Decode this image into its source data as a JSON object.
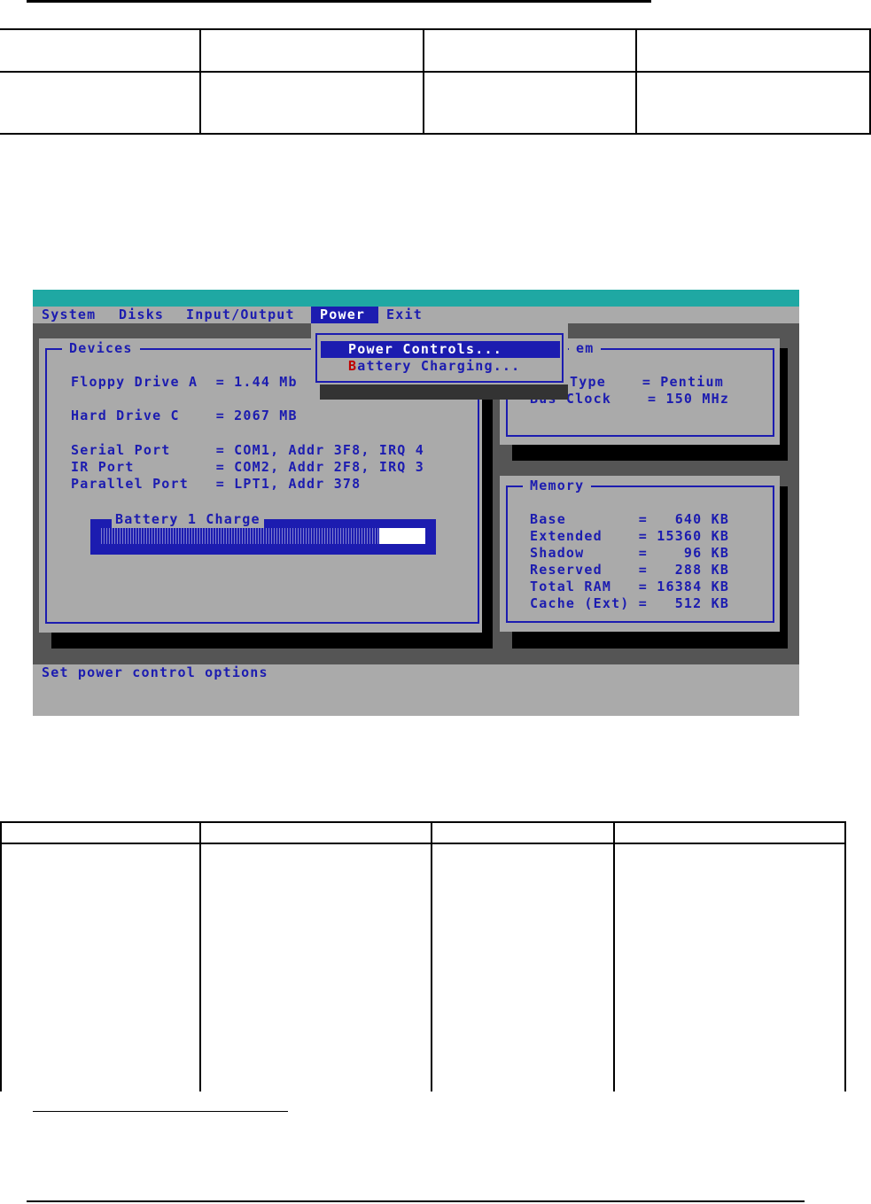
{
  "menu": {
    "system": "System",
    "disks": "Disks",
    "io": "Input/Output",
    "power": "Power",
    "exit": "Exit"
  },
  "dropdown": {
    "power_controls": "Power Controls...",
    "battery_hotkey": "B",
    "battery_rest": "attery Charging..."
  },
  "devices": {
    "title": "Devices",
    "rows": [
      "Floppy Drive A  = 1.44 Mb",
      "Hard Drive C    = 2067 MB",
      "Serial Port     = COM1, Addr 3F8, IRQ 4",
      "IR Port         = COM2, Addr 2F8, IRQ 3",
      "Parallel Port   = LPT1, Addr 378"
    ],
    "battery_title": "Battery 1 Charge",
    "battery_charge_fraction": 0.86
  },
  "system_panel": {
    "title_fragment": "em",
    "rows": [
      "Type    = Pentium",
      "Bus Clock    = 150 MHz"
    ]
  },
  "memory": {
    "title": "Memory",
    "rows": [
      "Base        =   640 KB",
      "Extended    = 15360 KB",
      "Shadow      =    96 KB",
      "Reserved    =   288 KB",
      "Total RAM   = 16384 KB",
      "Cache (Ext) =   512 KB"
    ]
  },
  "status": "Set power control options",
  "colors": {
    "bios_blue": "#1c1cb0",
    "bios_gray": "#aaaaaa",
    "title_teal": "#1fa8a3",
    "hotkey_red": "#c00000"
  }
}
